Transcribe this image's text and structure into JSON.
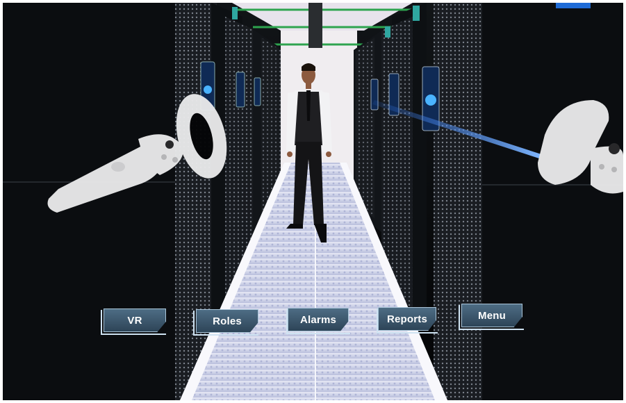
{
  "menu": {
    "buttons": [
      {
        "id": "vr",
        "label": "VR"
      },
      {
        "id": "roles",
        "label": "Roles"
      },
      {
        "id": "alarms",
        "label": "Alarms"
      },
      {
        "id": "reports",
        "label": "Reports"
      },
      {
        "id": "menu",
        "label": "Menu"
      }
    ]
  },
  "scene": {
    "colors": {
      "rack": "#0b0d10",
      "floor": "#c6cbe6",
      "laser": "#2f7bff",
      "controller": "#e9e9ea",
      "button_fill": "#3a5a74"
    },
    "icons": [
      "left-vr-controller-icon",
      "right-vr-controller-icon",
      "laser-pointer-icon",
      "avatar-figure-icon"
    ]
  }
}
